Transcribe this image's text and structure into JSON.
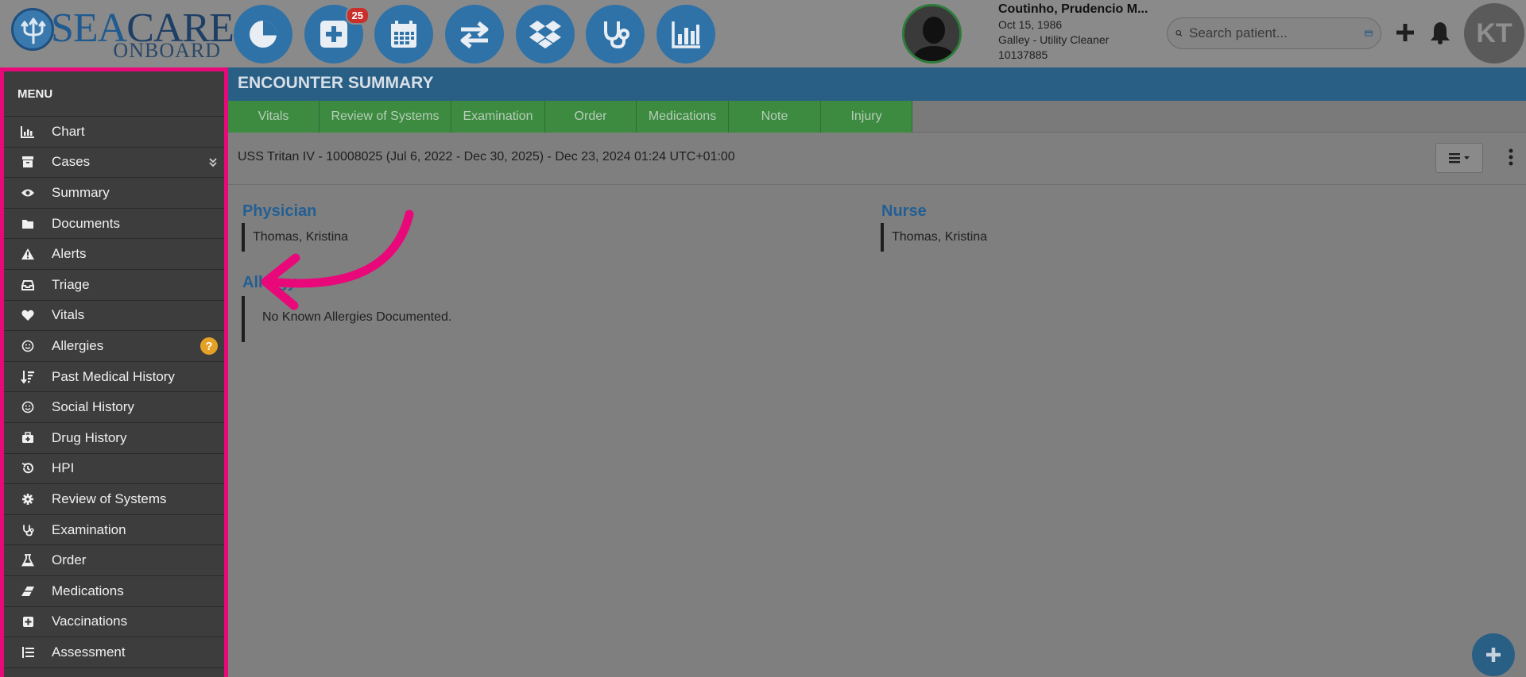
{
  "brand": {
    "logo_text_sea": "SEA",
    "logo_text_care": "CARE",
    "logo_text_onboard": "ONBOARD"
  },
  "nav": [
    {
      "id": "dashboard",
      "icon": "pie-chart-icon"
    },
    {
      "id": "new-encounter",
      "icon": "plus-square-icon",
      "badge": "25"
    },
    {
      "id": "calendar",
      "icon": "calendar-icon"
    },
    {
      "id": "transfer",
      "icon": "exchange-icon"
    },
    {
      "id": "dropbox",
      "icon": "dropbox-icon"
    },
    {
      "id": "stethoscope",
      "icon": "stethoscope-icon"
    },
    {
      "id": "reports",
      "icon": "bar-chart-icon"
    }
  ],
  "patient": {
    "name": "Coutinho, Prudencio M...",
    "dob": "Oct 15, 1986",
    "role": "Galley - Utility Cleaner",
    "id": "10137885"
  },
  "search": {
    "placeholder": "Search patient..."
  },
  "user": {
    "initials": "KT"
  },
  "menu": {
    "title": "MENU",
    "items": [
      {
        "label": "Chart",
        "icon": "bar-chart-icon"
      },
      {
        "label": "Cases",
        "icon": "archive-icon"
      },
      {
        "label": "Summary",
        "icon": "eye-icon"
      },
      {
        "label": "Documents",
        "icon": "folder-icon"
      },
      {
        "label": "Alerts",
        "icon": "warning-icon"
      },
      {
        "label": "Triage",
        "icon": "inbox-icon"
      },
      {
        "label": "Vitals",
        "icon": "heart-icon"
      },
      {
        "label": "Allergies",
        "icon": "smile-icon",
        "help": "?"
      },
      {
        "label": "Past Medical History",
        "icon": "sort-icon"
      },
      {
        "label": "Social History",
        "icon": "smile-icon"
      },
      {
        "label": "Drug History",
        "icon": "medkit-icon"
      },
      {
        "label": "HPI",
        "icon": "history-icon"
      },
      {
        "label": "Review of Systems",
        "icon": "cog-icon"
      },
      {
        "label": "Examination",
        "icon": "stethoscope-icon"
      },
      {
        "label": "Order",
        "icon": "flask-icon"
      },
      {
        "label": "Medications",
        "icon": "eraser-icon"
      },
      {
        "label": "Vaccinations",
        "icon": "plus-square-icon"
      },
      {
        "label": "Assessment",
        "icon": "list-icon"
      }
    ]
  },
  "encounter": {
    "title": "ENCOUNTER SUMMARY",
    "tabs": [
      "Vitals",
      "Review of Systems",
      "Examination",
      "Order",
      "Medications",
      "Note",
      "Injury"
    ],
    "context": "USS Tritan IV - 10008025 (Jul 6, 2022 - Dec 30, 2025) - Dec 23, 2024 01:24 UTC+01:00",
    "physician_label": "Physician",
    "physician_value": "Thomas, Kristina",
    "nurse_label": "Nurse",
    "nurse_value": "Thomas, Kristina",
    "allergy_label": "Allergy",
    "allergy_value": "No Known Allergies Documented."
  },
  "colors": {
    "highlight": "#e9087a",
    "nav_blue": "#2f72a8",
    "tab_green": "#3c8b41",
    "title_bar": "#2a5f85"
  }
}
